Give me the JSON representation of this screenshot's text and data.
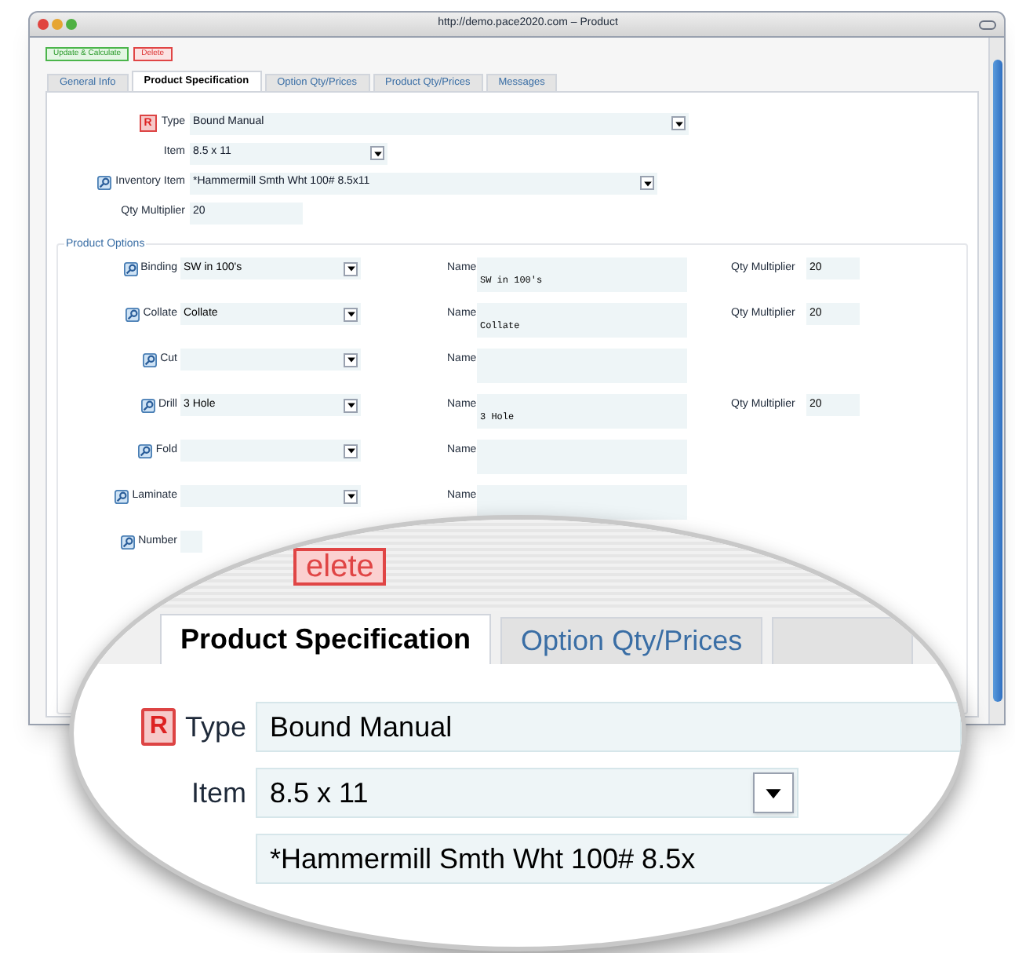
{
  "window": {
    "title": "http://demo.pace2020.com – Product"
  },
  "toolbar": {
    "buttons": [
      {
        "label": "Update & Calculate",
        "kind": "primary"
      },
      {
        "label": "Delete",
        "kind": "danger"
      }
    ]
  },
  "tabs": [
    {
      "label": "General Info",
      "selected": false
    },
    {
      "label": "Product Specification",
      "selected": true
    },
    {
      "label": "Option Qty/Prices",
      "selected": false
    },
    {
      "label": "Product Qty/Prices",
      "selected": false
    },
    {
      "label": "Messages",
      "selected": false
    }
  ],
  "fields": [
    {
      "kind": "required",
      "badge": "R",
      "label": "Type",
      "value": "Bound Manual"
    },
    {
      "kind": "select",
      "label": "Item",
      "value": "8.5 x 11"
    },
    {
      "kind": "lookup",
      "label": "Inventory Item",
      "value": "*Hammermill Smth Wht 100# 8.5x11"
    },
    {
      "kind": "input",
      "label": "Qty Multiplier",
      "value": "20"
    }
  ],
  "product_options": {
    "title": "Product Options",
    "rows": [
      {
        "label": "Binding",
        "value": "SW in 100's",
        "name_label": "Name",
        "name": "SW in 100's",
        "qty_label": "Qty Multiplier",
        "qty": "20"
      },
      {
        "label": "Collate",
        "value": "Collate",
        "name_label": "Name",
        "name": "Collate",
        "qty_label": "Qty Multiplier",
        "qty": "20"
      },
      {
        "label": "Cut",
        "name_label": "Name"
      },
      {
        "label": "Drill",
        "value": "3 Hole",
        "name_label": "Name",
        "name": "3 Hole",
        "qty_label": "Qty Multiplier",
        "qty": "20"
      },
      {
        "label": "Fold",
        "name_label": "Name"
      },
      {
        "label": "Laminate",
        "name_label": "Name"
      },
      {
        "label": "Number"
      }
    ]
  },
  "magnifier": {
    "button_text": "elete",
    "tabs": [
      {
        "label": "Product Specification",
        "selected": true
      },
      {
        "label": "Option Qty/Prices",
        "selected": false
      }
    ],
    "badge": "R",
    "type_label": "Type",
    "type_value": "Bound Manual",
    "item_label": "Item",
    "item_value": "8.5 x 11",
    "inventory_value": "*Hammermill Smth Wht 100# 8.5x"
  }
}
